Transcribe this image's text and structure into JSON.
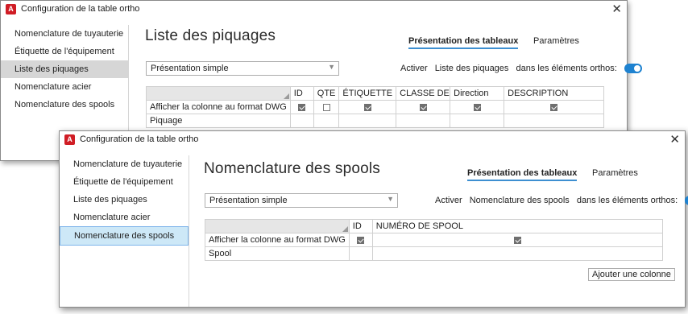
{
  "window1": {
    "title": "Configuration de la table ortho",
    "sidebar": [
      "Nomenclature de tuyauterie",
      "Étiquette de l'équipement",
      "Liste des piquages",
      "Nomenclature acier",
      "Nomenclature des spools"
    ],
    "page_title": "Liste des piquages",
    "tabs": [
      "Présentation des tableaux",
      "Paramètres"
    ],
    "dropdown_value": "Présentation simple",
    "toggle": {
      "activer": "Activer",
      "name": "Liste des piquages",
      "suffix": "dans les éléments orthos:",
      "on": true
    },
    "table": {
      "columns": [
        "ID",
        "QTE",
        "ÉTIQUETTE",
        "CLASSE DE PI",
        "Direction",
        "DESCRIPTION"
      ],
      "row_label": "Afficher la colonne au format DWG",
      "checks": [
        true,
        false,
        true,
        true,
        true,
        true
      ],
      "row2_label": "Piquage"
    }
  },
  "window2": {
    "title": "Configuration de la table ortho",
    "sidebar": [
      "Nomenclature de tuyauterie",
      "Étiquette de l'équipement",
      "Liste des piquages",
      "Nomenclature acier",
      "Nomenclature des spools"
    ],
    "page_title": "Nomenclature des spools",
    "tabs": [
      "Présentation des tableaux",
      "Paramètres"
    ],
    "dropdown_value": "Présentation simple",
    "toggle": {
      "activer": "Activer",
      "name": "Nomenclature des spools",
      "suffix": "dans les éléments orthos:",
      "on": true
    },
    "table": {
      "columns": [
        "ID",
        "NUMÉRO DE SPOOL"
      ],
      "row_label": "Afficher la colonne au format DWG",
      "checks": [
        true,
        true
      ],
      "row2_label": "Spool"
    },
    "add_column_button": "Ajouter une colonne"
  },
  "icons": {
    "app": "A",
    "close": "✕"
  },
  "colors": {
    "accent": "#1e82d0",
    "app_icon": "#d01d25",
    "selected_bg": "#cde8f7"
  }
}
